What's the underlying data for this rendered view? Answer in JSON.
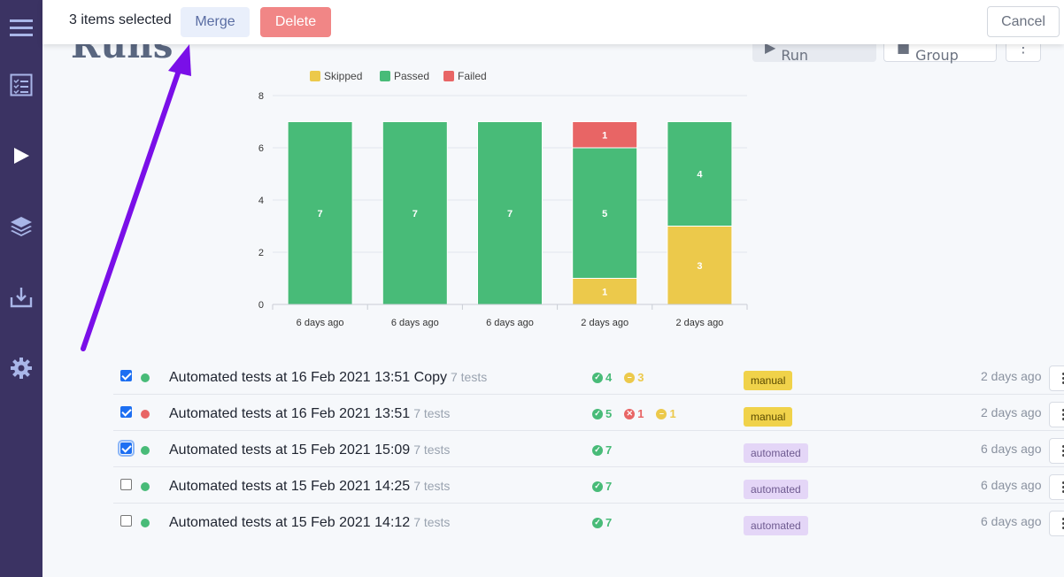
{
  "sidebar": {
    "items": [
      {
        "name": "menu-icon"
      },
      {
        "name": "checklist-icon"
      },
      {
        "name": "play-icon"
      },
      {
        "name": "layers-icon"
      },
      {
        "name": "import-icon"
      },
      {
        "name": "gear-icon"
      }
    ]
  },
  "page": {
    "title": "Runs",
    "manual_run_label": "Manual Run",
    "new_group_label": "New Group"
  },
  "selection_bar": {
    "count_text": "3 items selected",
    "merge_label": "Merge",
    "delete_label": "Delete",
    "cancel_label": "Cancel"
  },
  "colors": {
    "skipped": "#ecc94b",
    "passed": "#48bb78",
    "failed": "#e86565",
    "sidebar": "#3b3363",
    "arrow": "#7a0fe8"
  },
  "chart_data": {
    "type": "bar",
    "stacked": true,
    "categories": [
      "6 days ago",
      "6 days ago",
      "6 days ago",
      "2 days ago",
      "2 days ago"
    ],
    "series": [
      {
        "name": "Skipped",
        "values": [
          0,
          0,
          0,
          1,
          3
        ]
      },
      {
        "name": "Passed",
        "values": [
          7,
          7,
          7,
          5,
          4
        ]
      },
      {
        "name": "Failed",
        "values": [
          0,
          0,
          0,
          1,
          0
        ]
      }
    ],
    "ylim": [
      0,
      8
    ],
    "yticks": [
      0,
      2,
      4,
      6,
      8
    ],
    "legend_position": "top",
    "grid": true
  },
  "runs": [
    {
      "title": "Automated tests at 16 Feb 2021 13:51 Copy",
      "count": "7 tests",
      "checked": true,
      "focused": false,
      "status": "passed",
      "passed": "4",
      "failed": "",
      "skipped": "3",
      "tag": "manual",
      "ago": "2 days ago"
    },
    {
      "title": "Automated tests at 16 Feb 2021 13:51",
      "count": "7 tests",
      "checked": true,
      "focused": false,
      "status": "failed",
      "passed": "5",
      "failed": "1",
      "skipped": "1",
      "tag": "manual",
      "ago": "2 days ago"
    },
    {
      "title": "Automated tests at 15 Feb 2021 15:09",
      "count": "7 tests",
      "checked": true,
      "focused": true,
      "status": "passed",
      "passed": "7",
      "failed": "",
      "skipped": "",
      "tag": "automated",
      "ago": "6 days ago"
    },
    {
      "title": "Automated tests at 15 Feb 2021 14:25",
      "count": "7 tests",
      "checked": false,
      "focused": false,
      "status": "passed",
      "passed": "7",
      "failed": "",
      "skipped": "",
      "tag": "automated",
      "ago": "6 days ago"
    },
    {
      "title": "Automated tests at 15 Feb 2021 14:12",
      "count": "7 tests",
      "checked": false,
      "focused": false,
      "status": "passed",
      "passed": "7",
      "failed": "",
      "skipped": "",
      "tag": "automated",
      "ago": "6 days ago"
    }
  ]
}
